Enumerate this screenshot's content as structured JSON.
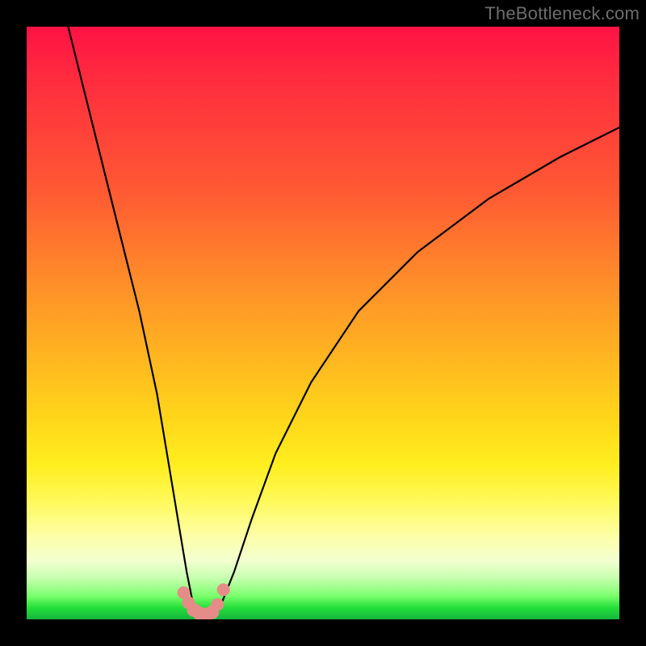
{
  "watermark": "TheBottleneck.com",
  "chart_data": {
    "type": "line",
    "title": "",
    "xlabel": "",
    "ylabel": "",
    "xlim": [
      0,
      100
    ],
    "ylim": [
      0,
      100
    ],
    "grid": false,
    "legend": false,
    "background_gradient": {
      "direction": "top-to-bottom",
      "stops": [
        {
          "pos": 0,
          "color": "#ff1244"
        },
        {
          "pos": 28,
          "color": "#ff5a33"
        },
        {
          "pos": 55,
          "color": "#ffb321"
        },
        {
          "pos": 74,
          "color": "#ffee1f"
        },
        {
          "pos": 90,
          "color": "#f4ffd0"
        },
        {
          "pos": 100,
          "color": "#14b53e"
        }
      ]
    },
    "series": [
      {
        "name": "bottleneck-curve",
        "color": "#000000",
        "x": [
          7,
          10,
          13,
          16,
          19,
          22,
          24,
          26,
          27,
          28,
          29,
          30,
          31,
          32,
          33,
          35,
          38,
          42,
          48,
          56,
          66,
          78,
          90,
          100
        ],
        "y": [
          100,
          88,
          76,
          64,
          52,
          38,
          26,
          14,
          8,
          3,
          1,
          0,
          0,
          1,
          3,
          8,
          17,
          28,
          40,
          52,
          62,
          71,
          78,
          83
        ]
      }
    ],
    "markers": [
      {
        "name": "valley-point",
        "x": 26.5,
        "y": 4.5,
        "r": 1.2,
        "color": "#e58b88"
      },
      {
        "name": "valley-point",
        "x": 27.3,
        "y": 2.8,
        "r": 1.2,
        "color": "#e58b88"
      },
      {
        "name": "valley-point",
        "x": 28.2,
        "y": 1.6,
        "r": 1.3,
        "color": "#e58b88"
      },
      {
        "name": "valley-point",
        "x": 29.2,
        "y": 1.0,
        "r": 1.3,
        "color": "#e58b88"
      },
      {
        "name": "valley-point",
        "x": 30.3,
        "y": 0.8,
        "r": 1.3,
        "color": "#e58b88"
      },
      {
        "name": "valley-point",
        "x": 31.3,
        "y": 1.2,
        "r": 1.3,
        "color": "#e58b88"
      },
      {
        "name": "valley-point",
        "x": 32.2,
        "y": 2.5,
        "r": 1.2,
        "color": "#e58b88"
      },
      {
        "name": "valley-point",
        "x": 33.2,
        "y": 5.0,
        "r": 1.2,
        "color": "#e58b88"
      }
    ]
  }
}
